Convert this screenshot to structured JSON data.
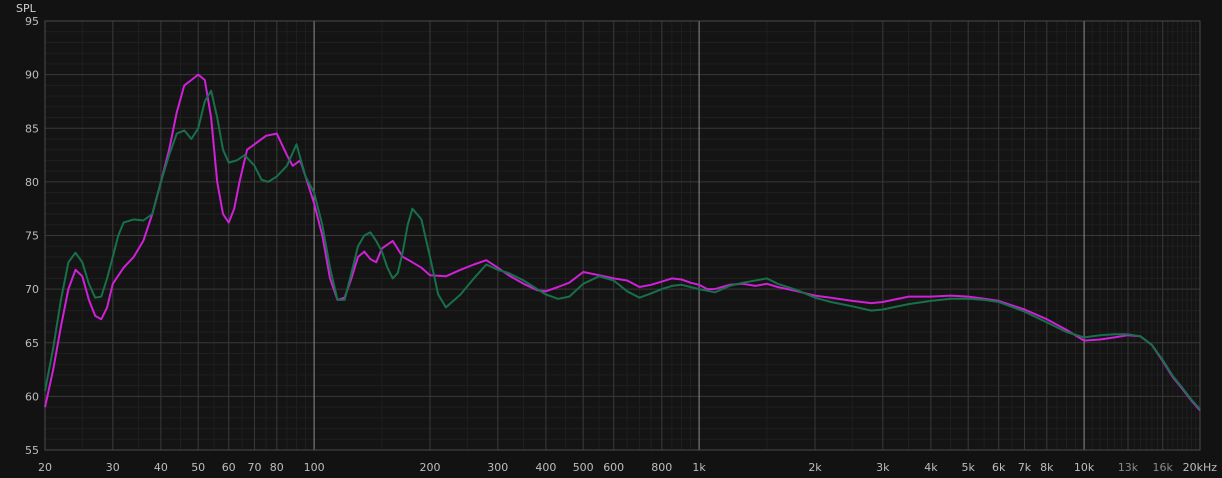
{
  "chart_data": {
    "type": "line",
    "ylabel": "SPL",
    "xscale": "log",
    "xlim": [
      20,
      20000
    ],
    "ylim": [
      55,
      95
    ],
    "grid": true,
    "y_ticks": [
      {
        "value": 55,
        "label": "55"
      },
      {
        "value": 60,
        "label": "60"
      },
      {
        "value": 65,
        "label": "65"
      },
      {
        "value": 70,
        "label": "70"
      },
      {
        "value": 75,
        "label": "75"
      },
      {
        "value": 80,
        "label": "80"
      },
      {
        "value": 85,
        "label": "85"
      },
      {
        "value": 90,
        "label": "90"
      },
      {
        "value": 95,
        "label": "95"
      }
    ],
    "x_ticks": [
      {
        "value": 20,
        "label": "20"
      },
      {
        "value": 30,
        "label": "30"
      },
      {
        "value": 40,
        "label": "40"
      },
      {
        "value": 50,
        "label": "50"
      },
      {
        "value": 60,
        "label": "60"
      },
      {
        "value": 70,
        "label": "70"
      },
      {
        "value": 80,
        "label": "80"
      },
      {
        "value": 100,
        "label": "100"
      },
      {
        "value": 200,
        "label": "200"
      },
      {
        "value": 300,
        "label": "300"
      },
      {
        "value": 400,
        "label": "400"
      },
      {
        "value": 500,
        "label": "500"
      },
      {
        "value": 600,
        "label": "600"
      },
      {
        "value": 800,
        "label": "800"
      },
      {
        "value": 1000,
        "label": "1k"
      },
      {
        "value": 2000,
        "label": "2k"
      },
      {
        "value": 3000,
        "label": "3k"
      },
      {
        "value": 4000,
        "label": "4k"
      },
      {
        "value": 5000,
        "label": "5k"
      },
      {
        "value": 6000,
        "label": "6k"
      },
      {
        "value": 7000,
        "label": "7k"
      },
      {
        "value": 8000,
        "label": "8k"
      },
      {
        "value": 10000,
        "label": "10k"
      },
      {
        "value": 13000,
        "label": "13k",
        "dim": true
      },
      {
        "value": 16000,
        "label": "16k",
        "dim": true
      },
      {
        "value": 20000,
        "label": "20kHz"
      }
    ],
    "series": [
      {
        "color": "#d020d8",
        "points": [
          [
            20,
            59
          ],
          [
            21,
            62.5
          ],
          [
            22,
            66.5
          ],
          [
            23,
            70
          ],
          [
            24,
            71.8
          ],
          [
            25,
            71.2
          ],
          [
            26,
            69
          ],
          [
            27,
            67.5
          ],
          [
            28,
            67.2
          ],
          [
            29,
            68.3
          ],
          [
            30,
            70.5
          ],
          [
            32,
            72
          ],
          [
            34,
            73
          ],
          [
            36,
            74.5
          ],
          [
            38,
            77
          ],
          [
            40,
            80
          ],
          [
            42,
            83
          ],
          [
            44,
            86.5
          ],
          [
            46,
            89
          ],
          [
            48,
            89.5
          ],
          [
            50,
            90
          ],
          [
            52,
            89.5
          ],
          [
            54,
            86
          ],
          [
            56,
            80
          ],
          [
            58,
            77
          ],
          [
            60,
            76.2
          ],
          [
            62,
            77.5
          ],
          [
            64,
            80
          ],
          [
            67,
            83
          ],
          [
            70,
            83.5
          ],
          [
            75,
            84.3
          ],
          [
            80,
            84.5
          ],
          [
            85,
            82.5
          ],
          [
            88,
            81.5
          ],
          [
            92,
            82
          ],
          [
            96,
            80
          ],
          [
            100,
            78
          ],
          [
            105,
            75
          ],
          [
            110,
            71
          ],
          [
            115,
            69
          ],
          [
            120,
            69.2
          ],
          [
            125,
            71
          ],
          [
            130,
            73
          ],
          [
            135,
            73.5
          ],
          [
            140,
            72.8
          ],
          [
            145,
            72.5
          ],
          [
            150,
            73.8
          ],
          [
            160,
            74.5
          ],
          [
            170,
            73
          ],
          [
            180,
            72.5
          ],
          [
            190,
            72
          ],
          [
            200,
            71.3
          ],
          [
            220,
            71.2
          ],
          [
            240,
            71.8
          ],
          [
            260,
            72.3
          ],
          [
            280,
            72.7
          ],
          [
            300,
            72
          ],
          [
            320,
            71.3
          ],
          [
            350,
            70.5
          ],
          [
            380,
            69.9
          ],
          [
            400,
            69.8
          ],
          [
            430,
            70.2
          ],
          [
            460,
            70.6
          ],
          [
            500,
            71.6
          ],
          [
            550,
            71.3
          ],
          [
            600,
            71
          ],
          [
            650,
            70.8
          ],
          [
            700,
            70.2
          ],
          [
            750,
            70.4
          ],
          [
            800,
            70.7
          ],
          [
            850,
            71
          ],
          [
            900,
            70.9
          ],
          [
            950,
            70.6
          ],
          [
            1000,
            70.4
          ],
          [
            1050,
            70
          ],
          [
            1100,
            70
          ],
          [
            1200,
            70.4
          ],
          [
            1300,
            70.5
          ],
          [
            1400,
            70.3
          ],
          [
            1500,
            70.5
          ],
          [
            1600,
            70.2
          ],
          [
            1800,
            69.8
          ],
          [
            2000,
            69.4
          ],
          [
            2200,
            69.2
          ],
          [
            2500,
            68.9
          ],
          [
            2800,
            68.7
          ],
          [
            3000,
            68.8
          ],
          [
            3500,
            69.3
          ],
          [
            4000,
            69.3
          ],
          [
            4500,
            69.4
          ],
          [
            5000,
            69.3
          ],
          [
            5500,
            69.1
          ],
          [
            6000,
            68.9
          ],
          [
            7000,
            68.1
          ],
          [
            8000,
            67.2
          ],
          [
            9000,
            66.2
          ],
          [
            10000,
            65.2
          ],
          [
            11000,
            65.3
          ],
          [
            12000,
            65.5
          ],
          [
            13000,
            65.7
          ],
          [
            14000,
            65.6
          ],
          [
            15000,
            64.8
          ],
          [
            16000,
            63.3
          ],
          [
            17000,
            61.8
          ],
          [
            18000,
            60.7
          ],
          [
            19000,
            59.6
          ],
          [
            20000,
            58.7
          ]
        ]
      },
      {
        "color": "#17704a",
        "points": [
          [
            20,
            60.5
          ],
          [
            21,
            64.5
          ],
          [
            22,
            69
          ],
          [
            23,
            72.5
          ],
          [
            24,
            73.4
          ],
          [
            25,
            72.5
          ],
          [
            26,
            70.5
          ],
          [
            27,
            69.2
          ],
          [
            28,
            69.3
          ],
          [
            29,
            71
          ],
          [
            30,
            73
          ],
          [
            31,
            75
          ],
          [
            32,
            76.2
          ],
          [
            34,
            76.5
          ],
          [
            36,
            76.4
          ],
          [
            38,
            77
          ],
          [
            40,
            80
          ],
          [
            42,
            82.5
          ],
          [
            44,
            84.5
          ],
          [
            46,
            84.8
          ],
          [
            48,
            84
          ],
          [
            50,
            85
          ],
          [
            52,
            87.5
          ],
          [
            54,
            88.5
          ],
          [
            56,
            86
          ],
          [
            58,
            83
          ],
          [
            60,
            81.8
          ],
          [
            63,
            82
          ],
          [
            66,
            82.5
          ],
          [
            70,
            81.5
          ],
          [
            73,
            80.2
          ],
          [
            76,
            80
          ],
          [
            80,
            80.5
          ],
          [
            85,
            81.5
          ],
          [
            90,
            83.5
          ],
          [
            95,
            80.5
          ],
          [
            100,
            79
          ],
          [
            105,
            76
          ],
          [
            110,
            72
          ],
          [
            115,
            69
          ],
          [
            120,
            69
          ],
          [
            125,
            71.5
          ],
          [
            130,
            74
          ],
          [
            135,
            75
          ],
          [
            140,
            75.3
          ],
          [
            145,
            74.5
          ],
          [
            150,
            73.5
          ],
          [
            155,
            72
          ],
          [
            160,
            71
          ],
          [
            165,
            71.5
          ],
          [
            170,
            73.5
          ],
          [
            175,
            76
          ],
          [
            180,
            77.5
          ],
          [
            190,
            76.5
          ],
          [
            200,
            73
          ],
          [
            210,
            69.5
          ],
          [
            220,
            68.3
          ],
          [
            240,
            69.5
          ],
          [
            260,
            71
          ],
          [
            280,
            72.3
          ],
          [
            300,
            71.8
          ],
          [
            320,
            71.5
          ],
          [
            350,
            70.8
          ],
          [
            380,
            70
          ],
          [
            400,
            69.5
          ],
          [
            430,
            69.1
          ],
          [
            460,
            69.3
          ],
          [
            500,
            70.5
          ],
          [
            550,
            71.2
          ],
          [
            600,
            70.8
          ],
          [
            650,
            69.8
          ],
          [
            700,
            69.2
          ],
          [
            750,
            69.6
          ],
          [
            800,
            70
          ],
          [
            850,
            70.3
          ],
          [
            900,
            70.4
          ],
          [
            950,
            70.2
          ],
          [
            1000,
            70
          ],
          [
            1100,
            69.7
          ],
          [
            1200,
            70.3
          ],
          [
            1300,
            70.6
          ],
          [
            1400,
            70.8
          ],
          [
            1500,
            71
          ],
          [
            1600,
            70.5
          ],
          [
            1800,
            69.9
          ],
          [
            2000,
            69.2
          ],
          [
            2200,
            68.8
          ],
          [
            2500,
            68.4
          ],
          [
            2800,
            68
          ],
          [
            3000,
            68.1
          ],
          [
            3500,
            68.6
          ],
          [
            4000,
            68.9
          ],
          [
            4500,
            69.1
          ],
          [
            5000,
            69.1
          ],
          [
            5500,
            69
          ],
          [
            6000,
            68.8
          ],
          [
            7000,
            67.9
          ],
          [
            8000,
            66.9
          ],
          [
            9000,
            66
          ],
          [
            10000,
            65.5
          ],
          [
            11000,
            65.7
          ],
          [
            12000,
            65.8
          ],
          [
            13000,
            65.8
          ],
          [
            14000,
            65.6
          ],
          [
            15000,
            64.8
          ],
          [
            16000,
            63.4
          ],
          [
            17000,
            61.9
          ],
          [
            18000,
            60.8
          ],
          [
            19000,
            59.7
          ],
          [
            20000,
            58.8
          ]
        ]
      }
    ]
  }
}
